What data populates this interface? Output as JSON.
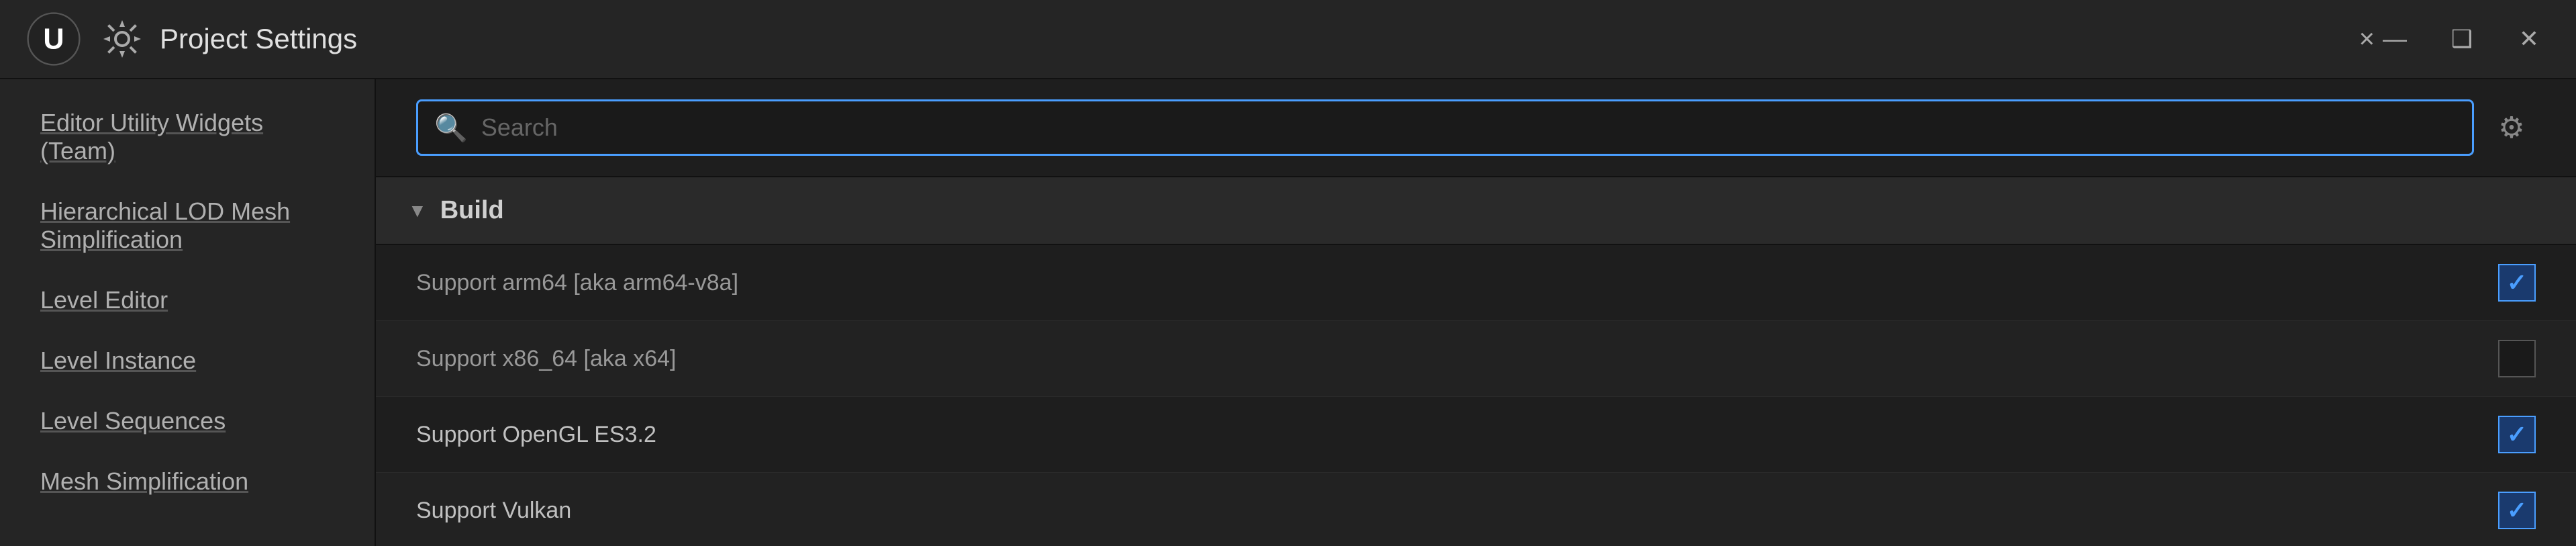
{
  "titleBar": {
    "appTitle": "Project Settings",
    "closeTabLabel": "×",
    "minimizeLabel": "—",
    "maximizeLabel": "❑",
    "closeLabel": "✕"
  },
  "sidebar": {
    "items": [
      {
        "id": "editor-utility-widgets",
        "label": "Editor Utility Widgets (Team)",
        "underline": true
      },
      {
        "id": "hierarchical-lod",
        "label": "Hierarchical LOD Mesh Simplification",
        "underline": true
      },
      {
        "id": "level-editor",
        "label": "Level Editor",
        "underline": true
      },
      {
        "id": "level-instance",
        "label": "Level Instance",
        "underline": true
      },
      {
        "id": "level-sequences",
        "label": "Level Sequences",
        "underline": true
      },
      {
        "id": "mesh-simplification",
        "label": "Mesh Simplification",
        "underline": true
      }
    ]
  },
  "search": {
    "placeholder": "Search",
    "value": ""
  },
  "sections": [
    {
      "id": "build",
      "title": "Build",
      "collapsed": false,
      "settings": [
        {
          "id": "support-arm64",
          "label": "Support arm64 [aka arm64-v8a]",
          "checked": true,
          "labelStyle": "muted"
        },
        {
          "id": "support-x86-64",
          "label": "Support x86_64 [aka x64]",
          "checked": false,
          "labelStyle": "muted"
        },
        {
          "id": "support-opengl-es32",
          "label": "Support OpenGL ES3.2",
          "checked": true,
          "labelStyle": "normal"
        },
        {
          "id": "support-vulkan",
          "label": "Support Vulkan",
          "checked": true,
          "labelStyle": "normal"
        }
      ]
    }
  ]
}
